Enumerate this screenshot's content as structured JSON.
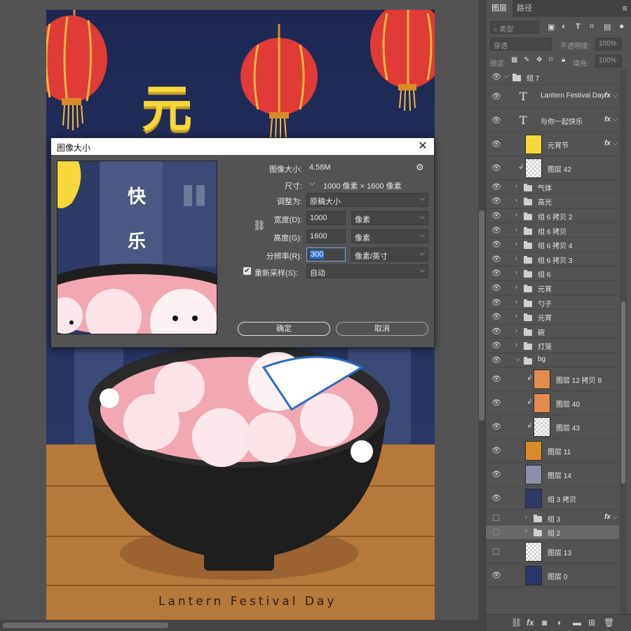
{
  "artwork": {
    "title_char": "元",
    "caption": "Lantern Festival Day",
    "preview_text_1": "快",
    "preview_text_2": "乐"
  },
  "dialog": {
    "title": "图像大小",
    "image_size_label": "图像大小:",
    "image_size_value": "4.58M",
    "dimensions_label": "尺寸:",
    "dimensions_value": "1000 像素 × 1600 像素",
    "fit_to_label": "调整为:",
    "fit_to_value": "原稿大小",
    "width_label": "宽度(D):",
    "width_value": "1000",
    "width_unit": "像素",
    "height_label": "高度(G):",
    "height_value": "1600",
    "height_unit": "像素",
    "resolution_label": "分辨率(R):",
    "resolution_value": "300",
    "resolution_unit": "像素/英寸",
    "resample_label": "重新采样(S):",
    "resample_checked": true,
    "resample_value": "自动",
    "ok_label": "确定",
    "cancel_label": "取消"
  },
  "panel": {
    "tabs": [
      "图层",
      "路径"
    ],
    "filter_kind": "类型",
    "blend_mode": "穿透",
    "opacity_label": "不透明度:",
    "opacity_value": "100%",
    "lock_label": "锁定:",
    "fill_label": "填充:",
    "fill_value": "100%"
  },
  "layers": [
    {
      "name": "组 7",
      "kind": "group-open",
      "visible": true,
      "fx": false
    },
    {
      "name": "Lantern Festival Day",
      "kind": "text",
      "visible": true,
      "fx": true
    },
    {
      "name": "与你一起快乐",
      "kind": "text",
      "visible": true,
      "fx": true
    },
    {
      "name": "元宵节",
      "kind": "image",
      "visible": true,
      "fx": true
    },
    {
      "name": "图层 42",
      "kind": "image-clip",
      "visible": true,
      "fx": false
    },
    {
      "name": "气体",
      "kind": "group",
      "visible": true,
      "fx": false
    },
    {
      "name": "高光",
      "kind": "group",
      "visible": true,
      "fx": false
    },
    {
      "name": "组 6 拷贝 2",
      "kind": "group",
      "visible": true,
      "fx": false
    },
    {
      "name": "组 6 拷贝",
      "kind": "group",
      "visible": true,
      "fx": false
    },
    {
      "name": "组 6 拷贝 4",
      "kind": "group",
      "visible": true,
      "fx": false
    },
    {
      "name": "组 6 拷贝 3",
      "kind": "group",
      "visible": true,
      "fx": false
    },
    {
      "name": "组 6",
      "kind": "group",
      "visible": true,
      "fx": false
    },
    {
      "name": "元宵",
      "kind": "group",
      "visible": true,
      "fx": false
    },
    {
      "name": "勺子",
      "kind": "group",
      "visible": true,
      "fx": false
    },
    {
      "name": "元宵",
      "kind": "group",
      "visible": true,
      "fx": false
    },
    {
      "name": "碗",
      "kind": "group",
      "visible": true,
      "fx": false
    },
    {
      "name": "灯笼",
      "kind": "group",
      "visible": true,
      "fx": false
    },
    {
      "name": "bg",
      "kind": "group-open",
      "visible": true,
      "fx": false
    },
    {
      "name": "图层 12 拷贝 8",
      "kind": "image-clip",
      "visible": true,
      "fx": false
    },
    {
      "name": "图层 40",
      "kind": "image-clip",
      "visible": true,
      "fx": false
    },
    {
      "name": "图层 43",
      "kind": "image-clip",
      "visible": true,
      "fx": false
    },
    {
      "name": "图层 11",
      "kind": "image",
      "visible": true,
      "fx": false
    },
    {
      "name": "图层 14",
      "kind": "image",
      "visible": true,
      "fx": false
    },
    {
      "name": "组 3 拷贝",
      "kind": "image",
      "visible": true,
      "fx": false
    },
    {
      "name": "组 3",
      "kind": "group",
      "visible": false,
      "fx": true
    },
    {
      "name": "组 2",
      "kind": "group",
      "visible": false,
      "fx": false
    },
    {
      "name": "图层 13",
      "kind": "image",
      "visible": false,
      "fx": false
    },
    {
      "name": "图层 0",
      "kind": "image",
      "visible": true,
      "fx": false
    }
  ],
  "colors": {
    "ps_panel": "#535353",
    "sky": "#1f2a54",
    "lantern": "#e03b35",
    "title_yellow": "#f4d83c",
    "soup_pink": "#f2a7b3",
    "bowl": "#1e1e1e",
    "table": "#b7793a",
    "selection_blue": "#2d6bd1"
  }
}
